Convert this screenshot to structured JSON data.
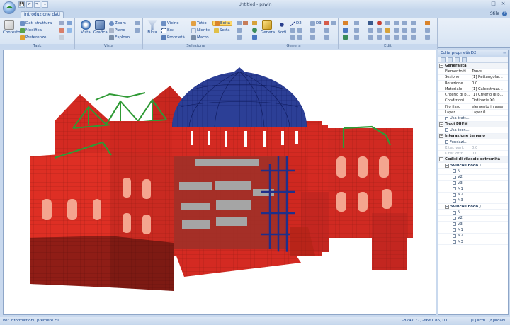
{
  "window": {
    "title": "Untitled - pswin",
    "controls": [
      "–",
      "□",
      "×"
    ]
  },
  "quick_access": [
    "💾",
    "↶",
    "↷",
    "▾"
  ],
  "tabs": [
    {
      "label": "Introduzione dati"
    }
  ],
  "top_right": {
    "style_label": "Stile",
    "help": "?"
  },
  "ribbon": {
    "task": {
      "label": "Task",
      "contesto": "Contesto",
      "dati_struttura": "Dati struttura",
      "modifica": "Modifica",
      "preferenze": "Preferenze"
    },
    "vista": {
      "label": "Vista",
      "vista": "Vista",
      "grafica": "Grafica",
      "zoom": "Zoom",
      "piano": "Piano",
      "esploso": "Esploso"
    },
    "selezione": {
      "label": "Selezione",
      "filtra": "Filtra",
      "vicino": "Vicino",
      "box": "Box",
      "proprieta": "Proprietà",
      "tutto": "Tutto",
      "niente": "Niente",
      "macro": "Macro",
      "edita": "Edita",
      "setta": "Setta"
    },
    "genera": {
      "label": "Genera",
      "genera": "Genera",
      "nodi": "Nodi",
      "d2": "D2",
      "d3": "D3"
    },
    "edit": {
      "label": "Edit"
    }
  },
  "panel": {
    "title": "Edita proprietà D2",
    "generalita": {
      "label": "Generalità",
      "rows": [
        {
          "k": "Elemento ti...",
          "v": "Trave"
        },
        {
          "k": "Sezione",
          "v": "[1] Rettangolar..."
        },
        {
          "k": "Rotazione",
          "v": "0.0"
        },
        {
          "k": "Materiale",
          "v": "[1] Calcestruzz..."
        },
        {
          "k": "Criterio di p...",
          "v": "[1] Criterio di p..."
        },
        {
          "k": "Condizioni ...",
          "v": "Ordinarie X0"
        },
        {
          "k": "Filo fisso",
          "v": "elemento in asse"
        },
        {
          "k": "Layer",
          "v": "Layer 0"
        }
      ],
      "usa_tratt": "Usa tratt..."
    },
    "travi_prem": {
      "label": "Travi PREM",
      "usa_tecn": "Usa tecn..."
    },
    "interazione": {
      "label": "Interazione terreno",
      "fondaz": "Fondazi...",
      "k_vert": "K ter. vert.",
      "k_vert_v": "0.0",
      "k_oriz": "K ter. oriz.",
      "k_oriz_v": "0.0"
    },
    "codici": {
      "label": "Codici di rilascio estremità",
      "svincoli_i": "Svincoli nodo I",
      "svincoli_j": "Svincoli nodo J",
      "dofs": [
        "N",
        "V2",
        "V3",
        "M1",
        "M2",
        "M3"
      ]
    }
  },
  "status": {
    "hint": "Per informazioni, premere F1",
    "coords": "-8247.77, -6661.86, 0.0",
    "unit1": "[L]=cm",
    "unit2": "[F]=daN"
  },
  "colors": {
    "brick_red": "#d42a22",
    "brick_dark": "#8f1d16",
    "dome_blue": "#2c3f96",
    "truss_green": "#2f9a35",
    "window_pink": "#f4a58f"
  }
}
